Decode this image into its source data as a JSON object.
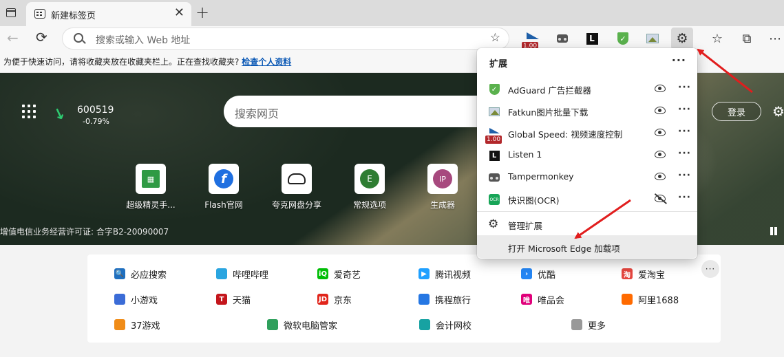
{
  "tab": {
    "title": "新建标签页",
    "close": "✕"
  },
  "newtab": "+",
  "address": {
    "placeholder": "搜索或输入 Web 地址"
  },
  "toolbar": {
    "speed_badge": "1.00"
  },
  "favbar": {
    "message": "为便于快速访问，请将收藏夹放在收藏夹栏上。正在查找收藏夹?",
    "link": "检查个人资料"
  },
  "stock": {
    "code": "600519",
    "change": "-0.79%"
  },
  "web_search": {
    "placeholder": "搜索网页"
  },
  "login": "登录",
  "quick_links": [
    {
      "label": "超级精灵手...",
      "icon": "超级"
    },
    {
      "label": "Flash官网",
      "icon": "f"
    },
    {
      "label": "夸克网盘分享",
      "icon": ""
    },
    {
      "label": "常规选项",
      "icon": "E"
    },
    {
      "label": "生成器",
      "icon": "IP"
    }
  ],
  "license": "增值电信业务经营许可证: 合字B2-20090007",
  "sites": [
    {
      "label": "必应搜索",
      "color": "#1f6fbf",
      "glyph": "🔍"
    },
    {
      "label": "哔哩哔哩",
      "color": "#2aa5e0",
      "glyph": ""
    },
    {
      "label": "爱奇艺",
      "color": "#00be06",
      "glyph": "iQ"
    },
    {
      "label": "腾讯视频",
      "color": "#20a0ff",
      "glyph": "▶"
    },
    {
      "label": "优酷",
      "color": "#2486f4",
      "glyph": "›"
    },
    {
      "label": "爱淘宝",
      "color": "#e4463f",
      "glyph": "淘"
    },
    {
      "label": "小游戏",
      "color": "#3b6cd7",
      "glyph": ""
    },
    {
      "label": "天猫",
      "color": "#c4161c",
      "glyph": "T"
    },
    {
      "label": "京东",
      "color": "#e1251b",
      "glyph": "JD"
    },
    {
      "label": "携程旅行",
      "color": "#2577e3",
      "glyph": ""
    },
    {
      "label": "唯品会",
      "color": "#e0007a",
      "glyph": "唯"
    },
    {
      "label": "阿里1688",
      "color": "#ff6a00",
      "glyph": ""
    },
    {
      "label": "37游戏",
      "color": "#f08c18",
      "glyph": ""
    },
    {
      "label": "微软电脑管家",
      "color": "#2fa05c",
      "glyph": ""
    },
    {
      "label": "会计网校",
      "color": "#17a2a2",
      "glyph": ""
    },
    {
      "label": "更多",
      "color": "#999999",
      "glyph": ""
    }
  ],
  "extensions": {
    "title": "扩展",
    "more": "···",
    "items": [
      {
        "name": "AdGuard 广告拦截器",
        "visible": true
      },
      {
        "name": "Fatkun图片批量下载",
        "visible": true
      },
      {
        "name": "Global Speed: 视频速度控制",
        "visible": true
      },
      {
        "name": "Listen 1",
        "visible": true
      },
      {
        "name": "Tampermonkey",
        "visible": true
      },
      {
        "name": "快识图(OCR)",
        "visible": false
      }
    ],
    "manage": "管理扩展",
    "open_addons": "打开 Microsoft Edge 加载项"
  },
  "colors": {
    "accent_arrow": "#e11d1d",
    "adguard": "#5ab14d",
    "link": "#0a58b5"
  }
}
